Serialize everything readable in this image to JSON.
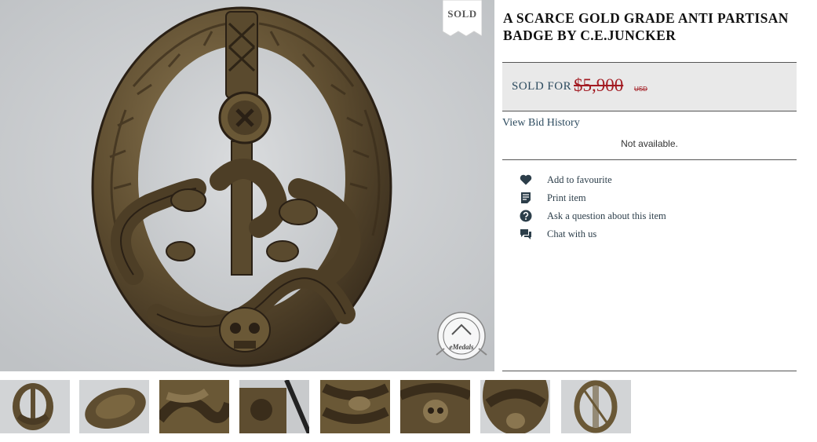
{
  "listing": {
    "title": "A SCARCE GOLD GRADE ANTI PARTISAN BADGE BY C.E.JUNCKER",
    "status_ribbon": "SOLD",
    "watermark_text": "eMedals"
  },
  "price": {
    "sold_label": "SOLD FOR",
    "amount": "$5,900",
    "currency": "USD"
  },
  "bid_history": {
    "link_label": "View Bid History",
    "status": "Not available."
  },
  "actions": [
    {
      "label": "Add to favourite",
      "icon": "heart-icon"
    },
    {
      "label": "Print item",
      "icon": "document-icon"
    },
    {
      "label": "Ask a question about this item",
      "icon": "question-icon"
    },
    {
      "label": "Chat with us",
      "icon": "chat-bubbles-icon"
    }
  ],
  "thumbnails": [
    "front",
    "angled",
    "detail-snakes",
    "detail-hilt",
    "detail-left",
    "detail-skull",
    "detail-bottom",
    "reverse"
  ],
  "colors": {
    "accent": "#2c4a5e",
    "price": "#a31c23",
    "badge_bronze": "#5a4a2e",
    "background_gray": "#cfd1d3"
  }
}
